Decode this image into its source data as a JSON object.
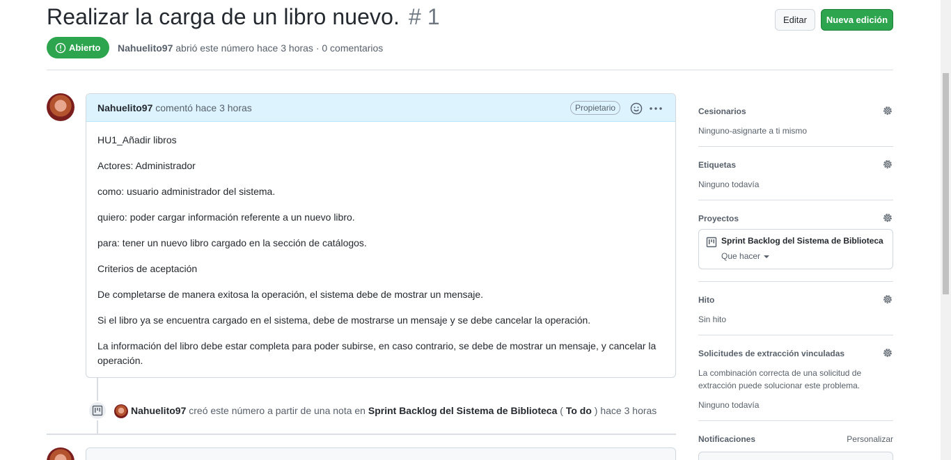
{
  "issue": {
    "title": "Realizar la carga de un libro nuevo.",
    "number": "# 1",
    "state_label": "Abierto",
    "author": "Nahuelito97",
    "meta_text": "abrió este número hace 3 horas · 0 comentarios"
  },
  "header_actions": {
    "edit_label": "Editar",
    "new_label": "Nueva edición"
  },
  "comment": {
    "author": "Nahuelito97",
    "time_text": "comentó hace 3 horas",
    "owner_badge": "Propietario",
    "paragraphs": [
      "HU1_Añadir libros",
      "Actores: Administrador",
      "como: usuario administrador del sistema.",
      "quiero: poder cargar información referente a un nuevo libro.",
      "para: tener un nuevo libro cargado en la sección de catálogos.",
      "Criterios de aceptación",
      "De completarse de manera exitosa la operación, el sistema debe de mostrar un mensaje.",
      "Si el libro ya se encuentra cargado en el sistema, debe de mostrarse un mensaje y se debe cancelar la operación.",
      "La información del libro debe estar completa para poder subirse, en caso contrario, se debe de mostrar un mensaje, y cancelar la operación."
    ]
  },
  "event": {
    "author": "Nahuelito97",
    "text_before": "creó este número a partir de una nota en",
    "project": "Sprint Backlog del Sistema de Biblioteca",
    "paren_open": "(",
    "column": "To do",
    "paren_close": ")",
    "time": "hace 3 horas"
  },
  "sidebar": {
    "assignees": {
      "title": "Cesionarios",
      "value": "Ninguno-asignarte a ti mismo"
    },
    "labels": {
      "title": "Etiquetas",
      "value": "Ninguno todavía"
    },
    "projects": {
      "title": "Proyectos",
      "project_name": "Sprint Backlog del Sistema de Biblioteca",
      "column": "Que hacer"
    },
    "milestone": {
      "title": "Hito",
      "value": "Sin hito"
    },
    "linked_prs": {
      "title": "Solicitudes de extracción vinculadas",
      "description": "La combinación correcta de una solicitud de extracción puede solucionar este problema.",
      "value": "Ninguno todavía"
    },
    "notifications": {
      "title": "Notificaciones",
      "customize": "Personalizar"
    }
  },
  "colors": {
    "open_green": "#2da44e",
    "comment_header_bg": "#ddf4ff",
    "muted_text": "#57606a"
  },
  "icons": {
    "state": "issue-opened-icon",
    "gear": "gear-icon",
    "project": "project-icon",
    "emoji": "smiley-icon",
    "more": "kebab-horizontal-icon"
  }
}
